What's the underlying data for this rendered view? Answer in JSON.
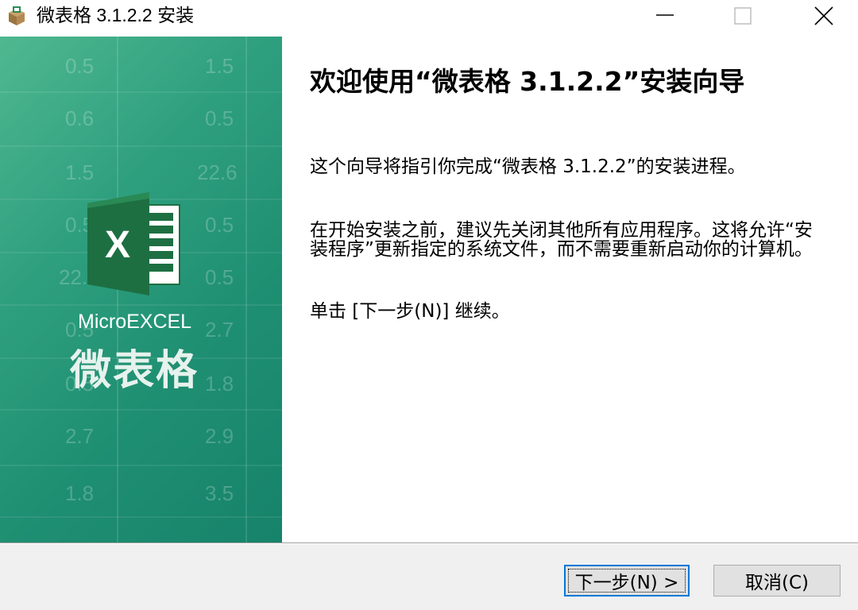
{
  "window": {
    "title": "微表格 3.1.2.2 安装"
  },
  "banner": {
    "brand_en": "MicroEXCEL",
    "brand_cn": "微表格",
    "background_numbers": [
      {
        "left": "0.5",
        "right": "1.5"
      },
      {
        "left": "0.6",
        "right": "0.5"
      },
      {
        "left": "1.5",
        "right": "22.6"
      },
      {
        "left": "0.5",
        "right": "0.5"
      },
      {
        "left": "22.6",
        "right": "0.5"
      },
      {
        "left": "0.5",
        "right": "2.7"
      },
      {
        "left": "0.5",
        "right": "1.8"
      },
      {
        "left": "2.7",
        "right": "2.9"
      },
      {
        "left": "1.8",
        "right": "3.5"
      }
    ]
  },
  "content": {
    "heading": "欢迎使用“微表格 3.1.2.2”安装向导",
    "paragraph1": "这个向导将指引你完成“微表格 3.1.2.2”的安装进程。",
    "paragraph2": "在开始安装之前，建议先关闭其他所有应用程序。这将允许“安装程序”更新指定的系统文件，而不需要重新启动你的计算机。",
    "paragraph3": "单击 [下一步(N)] 继续。"
  },
  "footer": {
    "next_label": "下一步(N) >",
    "cancel_label": "取消(C)"
  },
  "colors": {
    "accent": "#0078d7",
    "banner_green": "#2e9f7e",
    "excel_green": "#1d6f42"
  }
}
